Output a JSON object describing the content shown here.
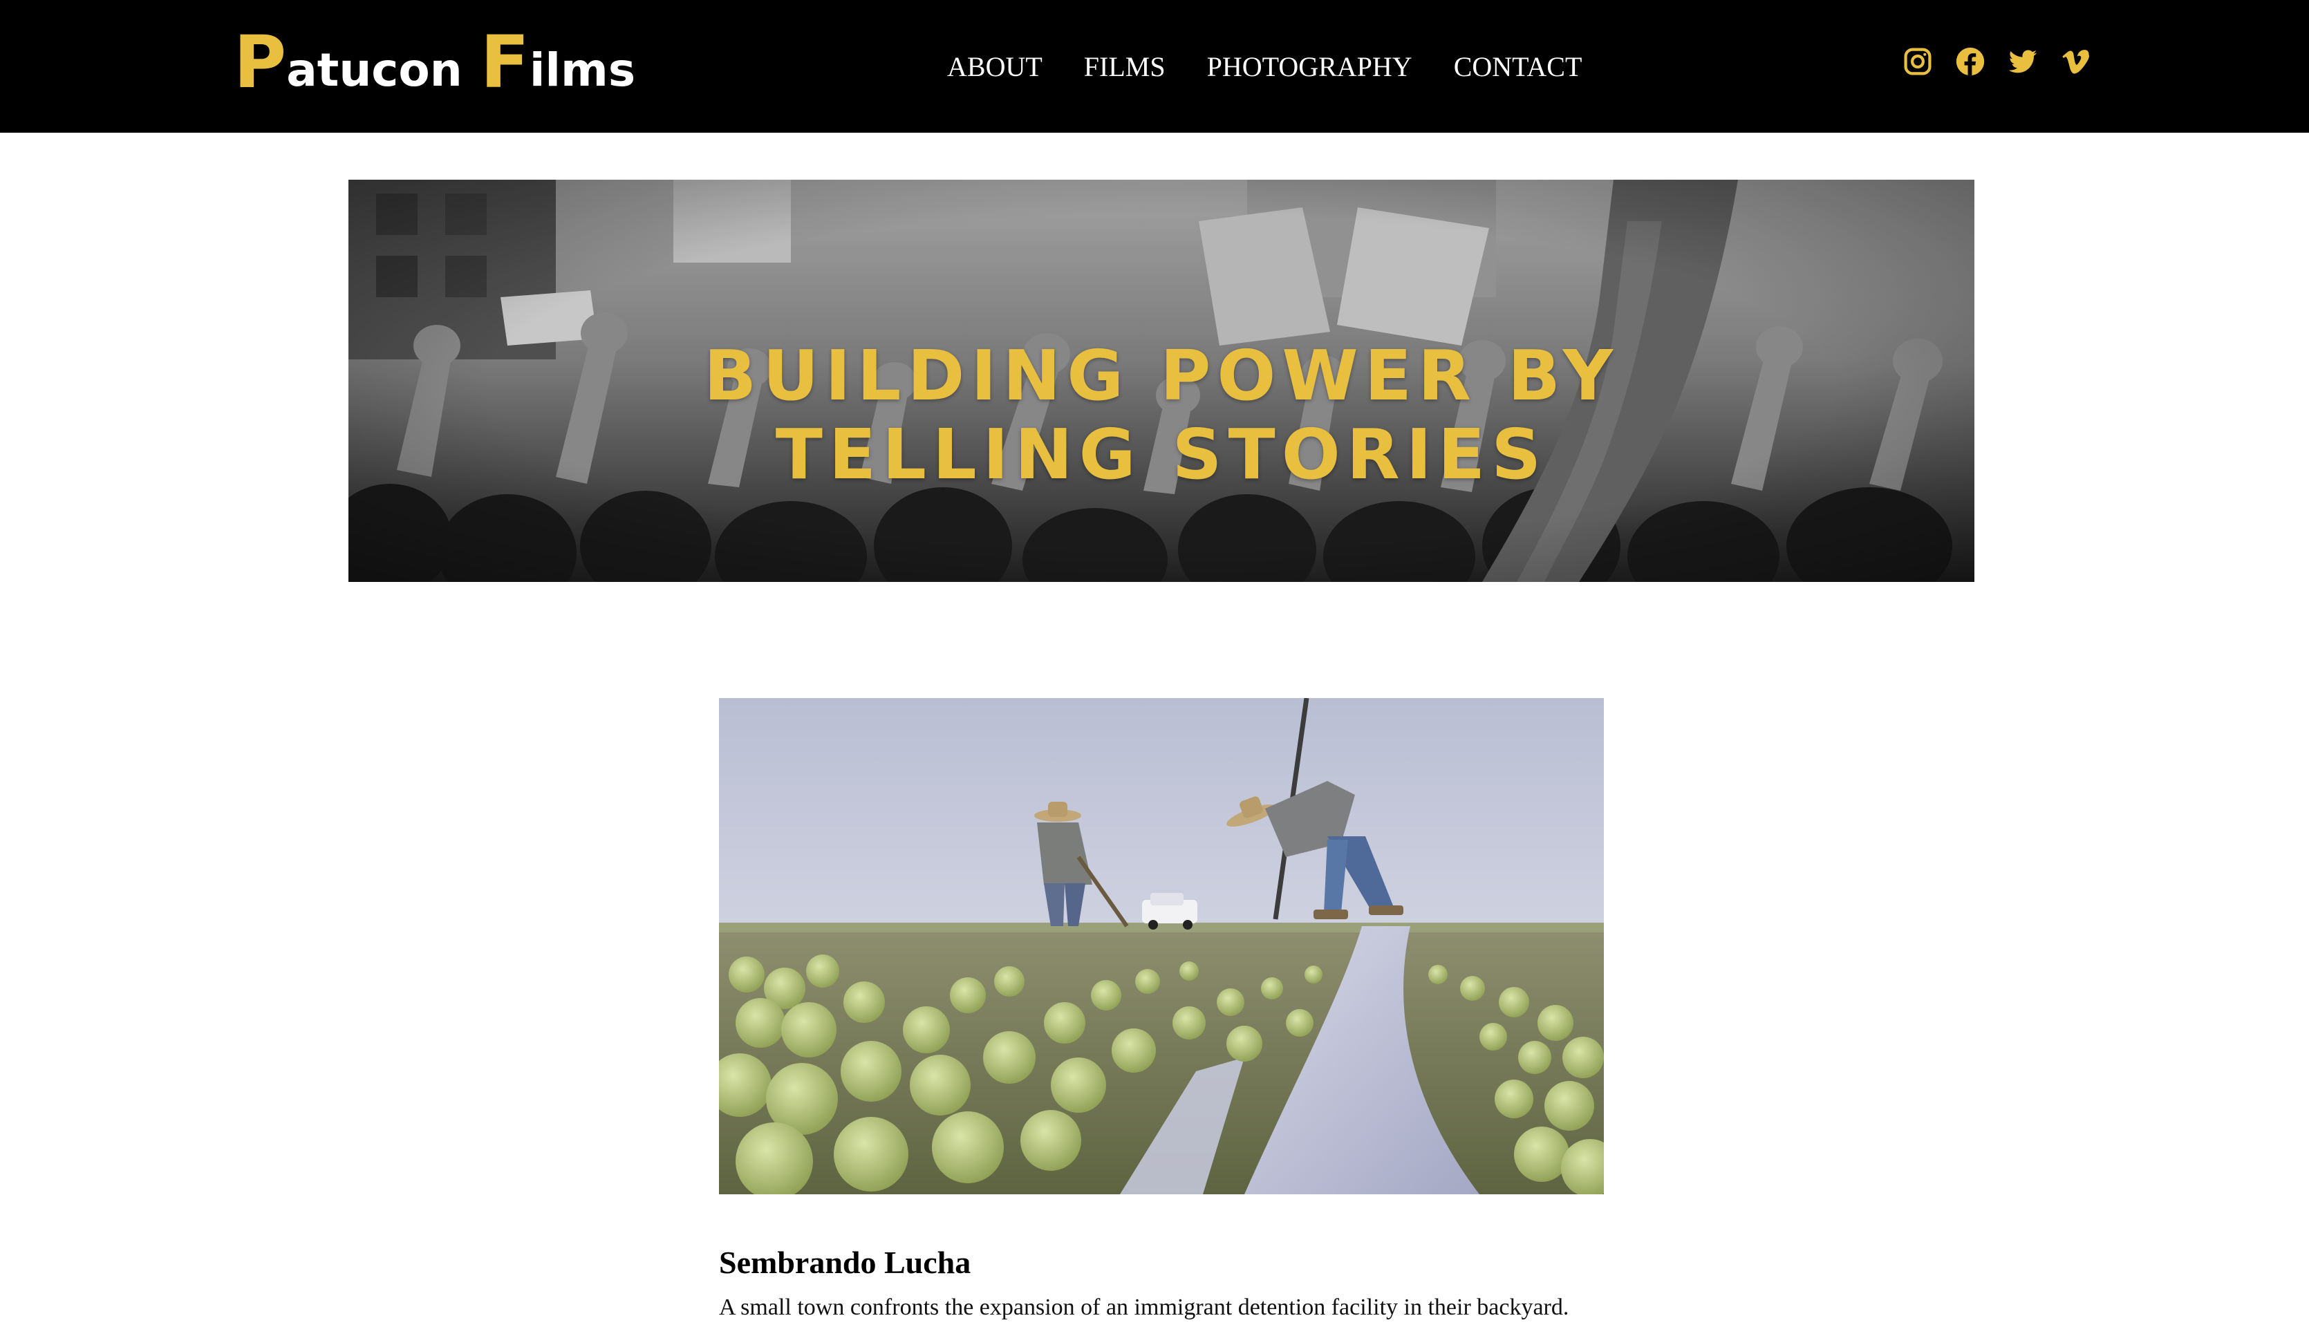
{
  "brand": {
    "logo_cap_1": "P",
    "logo_rest_1": "atucon",
    "logo_cap_2": "F",
    "logo_rest_2": "ilms",
    "accent_color": "#e9bf3f",
    "header_bg": "#000000"
  },
  "nav": {
    "items": [
      {
        "label": "ABOUT"
      },
      {
        "label": "FILMS"
      },
      {
        "label": "PHOTOGRAPHY"
      },
      {
        "label": "CONTACT"
      }
    ]
  },
  "social": {
    "icons": [
      "instagram-icon",
      "facebook-icon",
      "twitter-icon",
      "vimeo-icon"
    ]
  },
  "hero": {
    "title": "BUILDING POWER BY TELLING STORIES"
  },
  "featured_film": {
    "title": "Sembrando Lucha",
    "description": "A small town confronts the expansion of an immigrant detention facility in their backyard."
  }
}
